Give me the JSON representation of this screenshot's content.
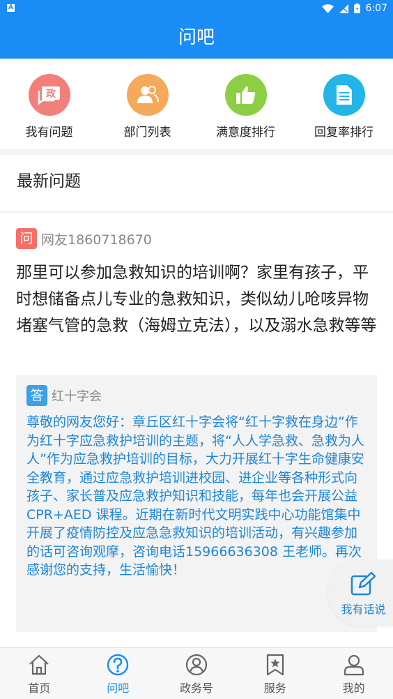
{
  "status_bar": {
    "time": "6:07",
    "left_icon_letter": "A"
  },
  "header": {
    "title": "问吧"
  },
  "shortcuts": [
    {
      "label": "我有问题",
      "icon": "chat-gov-icon",
      "color": "#f27f7a",
      "glyph": "政"
    },
    {
      "label": "部门列表",
      "icon": "people-icon",
      "color": "#f5a95a"
    },
    {
      "label": "满意度排行",
      "icon": "thumbs-up-icon",
      "color": "#8ccf45"
    },
    {
      "label": "回复率排行",
      "icon": "document-icon",
      "color": "#23b5e8"
    }
  ],
  "section": {
    "title": "最新问题"
  },
  "question": {
    "badge": "问",
    "asker": "网友1860718670",
    "text": "那里可以参加急救知识的培训啊？家里有孩子，平时想储备点儿专业的急救知识，类似幼儿呛咳异物堵塞气管的急救（海姆立克法），以及溺水急救等等"
  },
  "answer": {
    "badge": "答",
    "answerer": "红十字会",
    "text": "尊敬的网友您好：章丘区红十字会将“红十字救在身边”作为红十字应急救护培训的主题，将“人人学急救、急救为人人”作为应急救护培训的目标，大力开展红十字生命健康安全教育，通过应急救护培训进校园、进企业等各种形式向孩子、家长普及应急救护知识和技能，每年也会开展公益CPR+AED 课程。近期在新时代文明实践中心功能馆集中开展了疫情防控及应急急救知识的培训活动，有兴趣参加的话可咨询观摩，咨询电话15966636308 王老师。再次感谢您的支持，生活愉快！"
  },
  "fab": {
    "label": "我有话说",
    "icon": "edit-icon"
  },
  "tabs": [
    {
      "label": "首页",
      "icon": "home-icon",
      "active": false
    },
    {
      "label": "问吧",
      "icon": "question-circle-icon",
      "active": true
    },
    {
      "label": "政务号",
      "icon": "person-badge-icon",
      "active": false
    },
    {
      "label": "服务",
      "icon": "bookmark-star-icon",
      "active": false
    },
    {
      "label": "我的",
      "icon": "user-icon",
      "active": false
    }
  ],
  "colors": {
    "primary": "#1a8cf5",
    "answer_text": "#1e86d6",
    "question_badge": "#f47168",
    "answer_badge": "#3aa0e8"
  }
}
